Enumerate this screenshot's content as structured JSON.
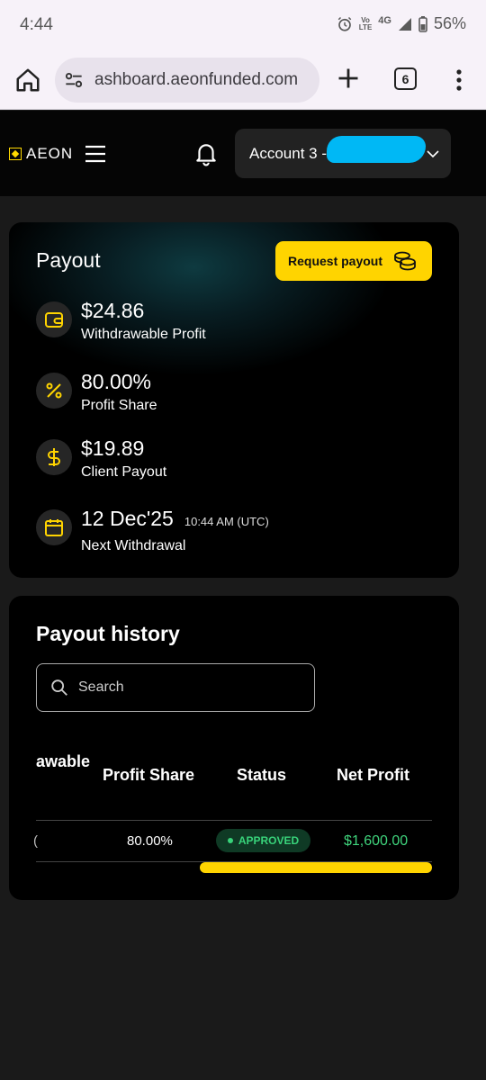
{
  "status_bar": {
    "time": "4:44",
    "volte_top": "Vo",
    "volte_mid": "LTE",
    "network": "4G",
    "battery": "56%"
  },
  "browser": {
    "url": "ashboard.aeonfunded.com",
    "tab_count": "6"
  },
  "app_header": {
    "logo_text": "AEON",
    "account_label": "Account 3 - D#"
  },
  "payout": {
    "title": "Payout",
    "request_button": "Request payout",
    "stats": [
      {
        "value": "$24.86",
        "label": "Withdrawable Profit",
        "icon": "wallet-icon"
      },
      {
        "value": "80.00%",
        "label": "Profit Share",
        "icon": "percent-icon"
      },
      {
        "value": "$19.89",
        "label": "Client Payout",
        "icon": "dollar-icon"
      },
      {
        "value": "12 Dec'25",
        "time": "10:44 AM (UTC)",
        "label": "Next Withdrawal",
        "icon": "calendar-icon"
      }
    ]
  },
  "history": {
    "title": "Payout history",
    "search_placeholder": "Search",
    "columns": [
      "awable",
      "Profit Share",
      "Status",
      "Net Profit"
    ],
    "rows": [
      {
        "partial": "(",
        "profit_share": "80.00%",
        "status": "APPROVED",
        "net_profit": "$1,600.00"
      }
    ]
  },
  "colors": {
    "accent": "#ffd400",
    "success": "#38d37a",
    "card_bg": "#000000",
    "page_bg": "#1a1a1a"
  }
}
